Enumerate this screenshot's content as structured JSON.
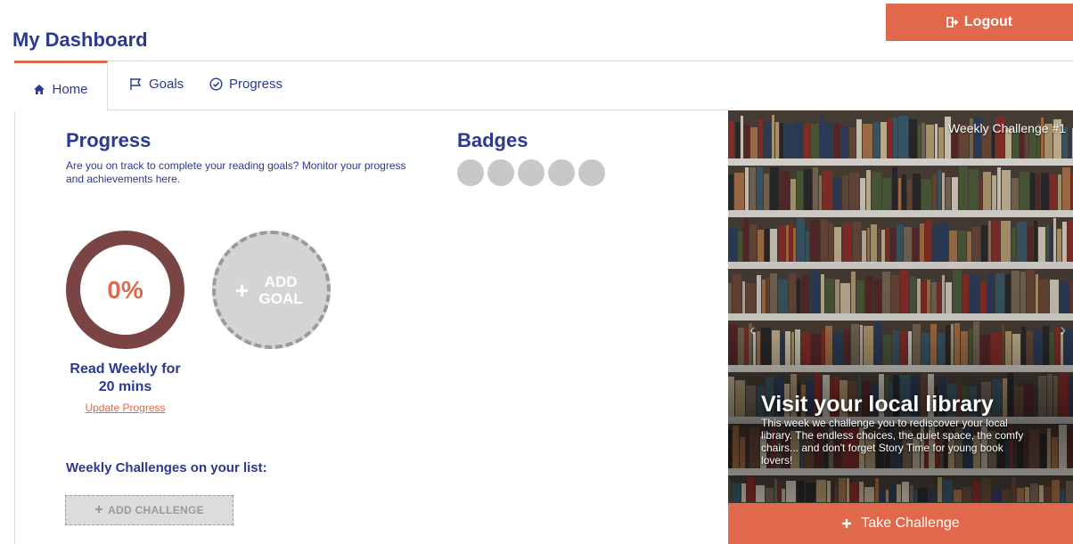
{
  "header": {
    "title": "My Dashboard",
    "logout_label": "Logout"
  },
  "tabs": [
    {
      "label": "Home",
      "icon": "home-icon",
      "active": true
    },
    {
      "label": "Goals",
      "icon": "flag-icon",
      "active": false
    },
    {
      "label": "Progress",
      "icon": "check-circle-icon",
      "active": false
    }
  ],
  "progress": {
    "title": "Progress",
    "description": "Are you on track to complete your reading goals? Monitor your progress and achievements here."
  },
  "badges": {
    "title": "Badges",
    "count": 5
  },
  "goal": {
    "percent": "0%",
    "name": "Read Weekly for 20 mins",
    "update_link": "Update Progress"
  },
  "add_goal": {
    "plus": "+",
    "label": "ADD GOAL"
  },
  "challenges": {
    "heading": "Weekly Challenges on your list:",
    "add_label": "ADD CHALLENGE"
  },
  "carousel": {
    "tag": "Weekly Challenge #1",
    "title": "Visit your local library",
    "description": "This week we challenge you to rediscover your local library. The endless choices, the quiet space, the comfy chairs... and don't forget Story Time for young book lovers!",
    "button_label": "Take Challenge",
    "prev": "‹",
    "next": "›"
  },
  "colors": {
    "brand_navy": "#2b3990",
    "accent_orange": "#e0694b",
    "ring_maroon": "#7a4444",
    "placeholder_grey": "#c8c8c8"
  }
}
